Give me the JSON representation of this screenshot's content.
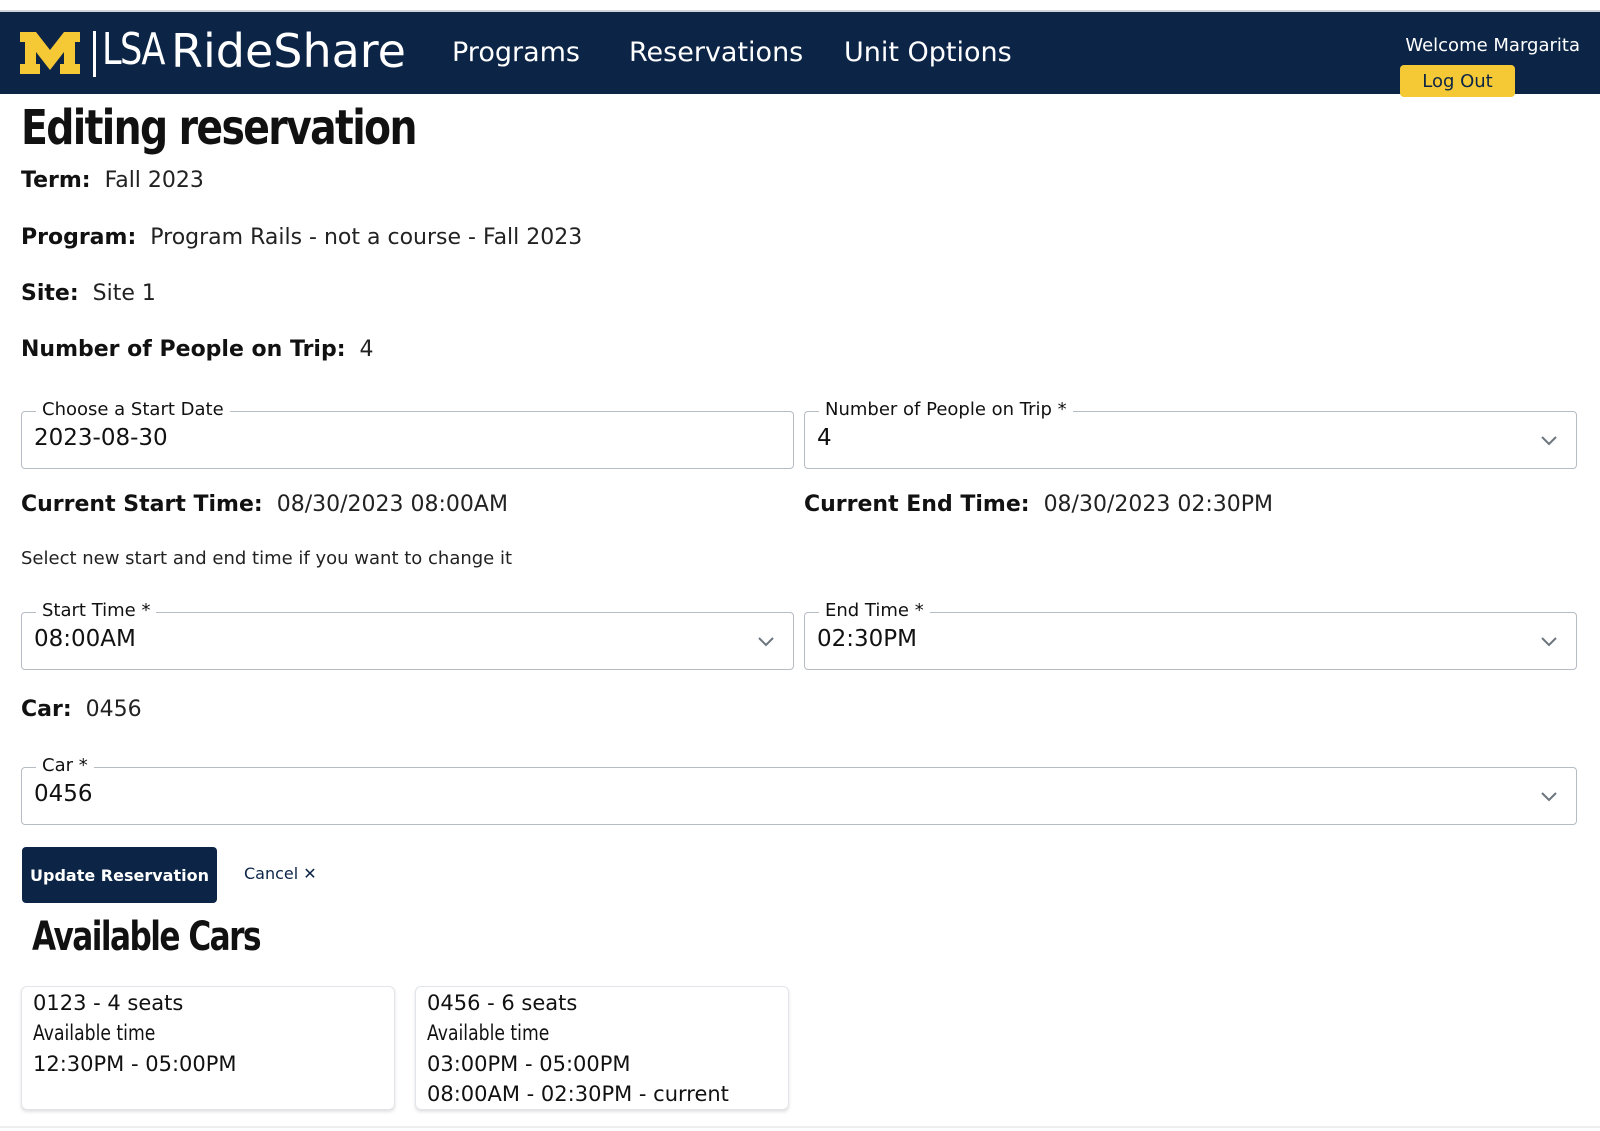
{
  "navbar": {
    "brand_lsa": "LSA",
    "brand_name": "RideShare",
    "links": [
      {
        "label": "Programs"
      },
      {
        "label": "Reservations"
      },
      {
        "label": "Unit Options"
      }
    ],
    "welcome": "Welcome Margarita",
    "logout_label": "Log Out",
    "colors": {
      "bar": "#0c2547",
      "accent": "#f5c935"
    }
  },
  "page": {
    "title": "Editing reservation"
  },
  "info": {
    "term_label": "Term:",
    "term_value": "Fall 2023",
    "program_label": "Program:",
    "program_value": "Program Rails - not a course - Fall 2023",
    "site_label": "Site:",
    "site_value": "Site 1",
    "people_label": "Number of People on Trip:",
    "people_value": "4"
  },
  "form": {
    "start_date": {
      "label": "Choose a Start Date",
      "value": "2023-08-30"
    },
    "people": {
      "label": "Number of People on Trip *",
      "value": "4"
    },
    "current_start_label": "Current Start Time:",
    "current_start_value": "08/30/2023 08:00AM",
    "current_end_label": "Current End Time:",
    "current_end_value": "08/30/2023 02:30PM",
    "hint": "Select new start and end time if you want to change it",
    "start_time": {
      "label": "Start Time *",
      "value": "08:00AM"
    },
    "end_time": {
      "label": "End Time *",
      "value": "02:30PM"
    },
    "car_label": "Car:",
    "car_value": "0456",
    "car_select": {
      "label": "Car *",
      "value": "0456"
    },
    "update_label": "Update Reservation",
    "cancel_label": "Cancel ✕"
  },
  "available_cars": {
    "title": "Available Cars",
    "cards": [
      {
        "title": "0123 - 4 seats",
        "avail_label": "Available time",
        "slots": [
          "12:30PM - 05:00PM"
        ]
      },
      {
        "title": "0456 - 6 seats",
        "avail_label": "Available time",
        "slots": [
          "03:00PM - 05:00PM",
          "08:00AM - 02:30PM - current"
        ]
      }
    ]
  }
}
